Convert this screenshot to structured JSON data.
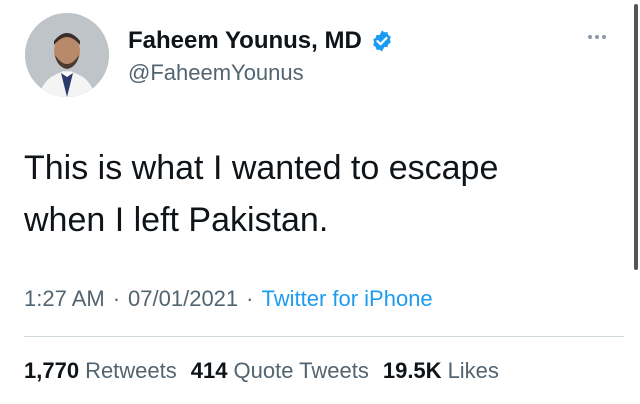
{
  "author": {
    "display_name": "Faheem Younus, MD",
    "handle": "@FaheemYounus",
    "verified": true,
    "avatar_icon": "profile-photo"
  },
  "tweet": {
    "text_line1": "This is what I wanted to escape",
    "text_line2": "when I left Pakistan.",
    "time": "1:27 AM",
    "date": "07/01/2021",
    "source": "Twitter for iPhone",
    "separator": "·"
  },
  "stats": {
    "retweets_count": "1,770",
    "retweets_label": "Retweets",
    "quotes_count": "414",
    "quotes_label": "Quote Tweets",
    "likes_count": "19.5K",
    "likes_label": "Likes"
  },
  "colors": {
    "accent": "#1d9bf0",
    "text": "#0f1419",
    "secondary": "#536471"
  }
}
